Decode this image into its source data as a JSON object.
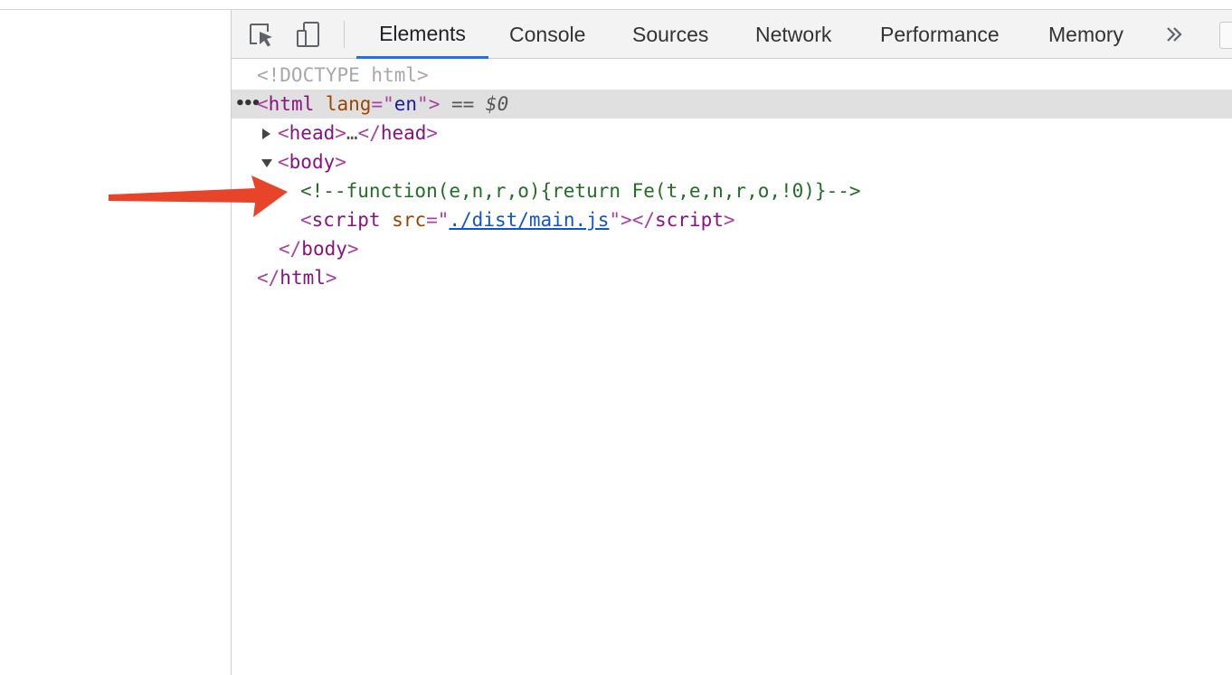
{
  "tabs": {
    "elements": "Elements",
    "console": "Console",
    "sources": "Sources",
    "network": "Network",
    "performance": "Performance",
    "memory": "Memory"
  },
  "toolbar": {
    "more_label": "»"
  },
  "tree": {
    "doctype": "<!DOCTYPE html>",
    "html_open": {
      "lt": "<",
      "tag": "html",
      "attr_name": " lang",
      "eq": "=\"",
      "attr_value": "en",
      "close": "\">",
      "selected_marker": " == ",
      "dollar": "$0"
    },
    "head": {
      "open": "<",
      "tag": "head",
      "gt": ">",
      "ellipsis": "…",
      "close_open": "</",
      "close_tag": "head",
      "close_gt": ">"
    },
    "body_open": {
      "lt": "<",
      "tag": "body",
      "gt": ">"
    },
    "comment": "<!--function(e,n,r,o){return Fe(t,e,n,r,o,!0)}-->",
    "script": {
      "lt": "<",
      "tag": "script",
      "attr_name": " src",
      "eq": "=\"",
      "src": "./dist/main.js",
      "close": "\">",
      "end_lt": "</",
      "end_tag": "script",
      "end_gt": ">"
    },
    "body_close": {
      "lt": "</",
      "tag": "body",
      "gt": ">"
    },
    "html_close": {
      "lt": "</",
      "tag": "html",
      "gt": ">"
    }
  },
  "colors": {
    "tag": "#881280",
    "attribute": "#994500",
    "value": "#1a1aa6",
    "comment": "#236e25",
    "link": "#1155cc",
    "active_tab_underline": "#1a73e8",
    "annotation_arrow": "#e8442a"
  },
  "icons": [
    "inspect-element-icon",
    "device-toolbar-icon",
    "more-tabs-icon",
    "expand-triangle-icon",
    "collapse-triangle-icon"
  ]
}
